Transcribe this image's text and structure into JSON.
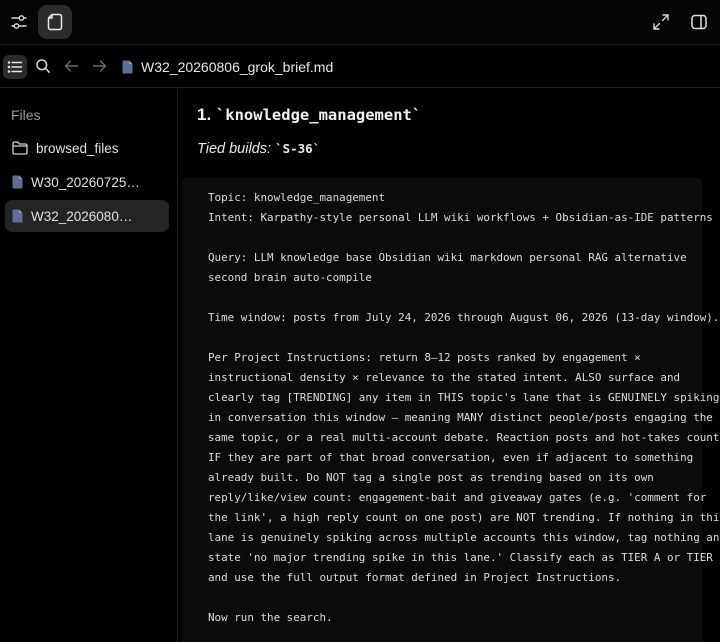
{
  "toolbar": {
    "sliders_icon": "sliders-icon",
    "file_icon": "file-icon",
    "expand_icon": "expand-icon",
    "panel_icon": "sidebar-panel-icon"
  },
  "nav": {
    "list_icon": "list-icon",
    "search_icon": "search-icon",
    "back_icon": "arrow-left-icon",
    "forward_icon": "arrow-right-icon",
    "doc_title": "W32_20260806_grok_brief.md"
  },
  "sidebar": {
    "heading": "Files",
    "items": [
      {
        "label": "browsed_files",
        "icon": "folder-icon"
      },
      {
        "label": "W30_20260725…",
        "icon": "document-icon"
      },
      {
        "label": "W32_2026080…",
        "icon": "document-icon",
        "active": true
      }
    ]
  },
  "main": {
    "heading_number": "1.",
    "heading_code": "`knowledge_management`",
    "tied_label": "Tied builds: ",
    "tied_code": "`S-36`",
    "code_text": "Topic: knowledge_management\nIntent: Karpathy-style personal LLM wiki workflows + Obsidian-as-IDE patterns\n\nQuery: LLM knowledge base Obsidian wiki markdown personal RAG alternative\nsecond brain auto-compile\n\nTime window: posts from July 24, 2026 through August 06, 2026 (13-day window).\n\nPer Project Instructions: return 8–12 posts ranked by engagement ×\ninstructional density × relevance to the stated intent. ALSO surface and\nclearly tag [TRENDING] any item in THIS topic's lane that is GENUINELY spiking\nin conversation this window — meaning MANY distinct people/posts engaging the\nsame topic, or a real multi-account debate. Reaction posts and hot-takes count\nIF they are part of that broad conversation, even if adjacent to something\nalready built. Do NOT tag a single post as trending based on its own\nreply/like/view count: engagement-bait and giveaway gates (e.g. 'comment for\nthe link', a high reply count on one post) are NOT trending. If nothing in this\nlane is genuinely spiking across multiple accounts this window, tag nothing and\nstate 'no major trending spike in this lane.' Classify each as TIER A or TIER B\nand use the full output format defined in Project Instructions.\n\nNow run the search."
  }
}
